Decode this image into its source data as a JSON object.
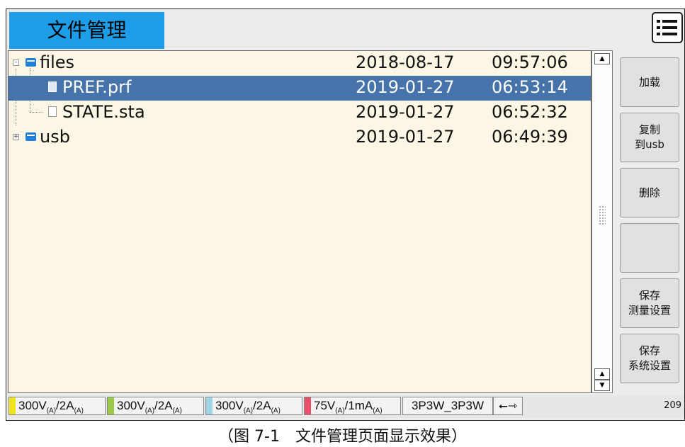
{
  "header": {
    "title": "文件管理",
    "menu_icon": "hamburger-menu-icon"
  },
  "files": [
    {
      "name": "files",
      "type": "folder",
      "date": "2018-08-17",
      "time": "09:57:06",
      "expanded": true,
      "level": 0
    },
    {
      "name": "PREF.prf",
      "type": "file",
      "date": "2019-01-27",
      "time": "06:53:14",
      "selected": true,
      "level": 1
    },
    {
      "name": "STATE.sta",
      "type": "file",
      "date": "2019-01-27",
      "time": "06:52:32",
      "level": 1
    },
    {
      "name": "usb",
      "type": "folder",
      "date": "2019-01-27",
      "time": "06:49:39",
      "expanded": false,
      "level": 0
    }
  ],
  "scrollbar": {
    "up_icon": "arrow-up-icon",
    "down_icon": "arrow-down-icon",
    "up_glyph": "▲",
    "down_glyph": "▼"
  },
  "side_buttons": [
    {
      "label": "加载"
    },
    {
      "label": "复制\n到usb"
    },
    {
      "label": "删除"
    },
    {
      "label": ""
    },
    {
      "label": "保存\n测量设置"
    },
    {
      "label": "保存\n系统设置"
    }
  ],
  "status_bar": {
    "ranges": [
      {
        "voltage": "300V",
        "vsub": "(A)",
        "current": "/2A",
        "csub": "(A)",
        "color": "#f2e41c"
      },
      {
        "voltage": "300V",
        "vsub": "(A)",
        "current": "/2A",
        "csub": "(A)",
        "color": "#9cc94a"
      },
      {
        "voltage": "300V",
        "vsub": "(A)",
        "current": "/2A",
        "csub": "(A)",
        "color": "#9fd3e6"
      },
      {
        "voltage": "75V",
        "vsub": "(A)",
        "current": "/1mA",
        "csub": "(A)",
        "color": "#e8506a"
      }
    ],
    "wiring": "3P3W_3P3W",
    "usb_icon": "usb-icon",
    "clock": "209"
  },
  "caption": "（图 7-1　文件管理页面显示效果）"
}
